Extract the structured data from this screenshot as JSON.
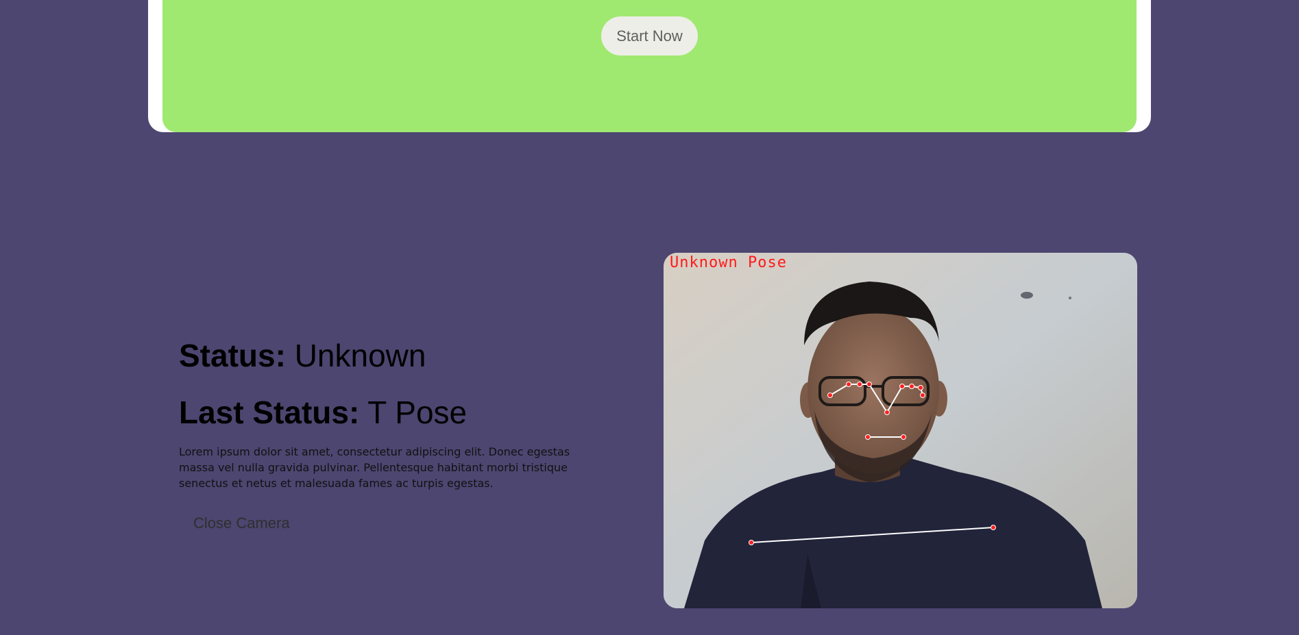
{
  "hero": {
    "start_button_label": "Start Now"
  },
  "status": {
    "status_label": "Status:",
    "status_value": "Unknown",
    "last_status_label": "Last Status:",
    "last_status_value": "T Pose",
    "description": "Lorem ipsum dolor sit amet, consectetur adipiscing elit. Donec egestas massa vel nulla gravida pulvinar. Pellentesque habitant morbi tristique senectus et netus et malesuada fames ac turpis egestas.",
    "close_button_label": "Close Camera"
  },
  "camera": {
    "overlay_label": "Unknown Pose",
    "overlay_color": "#ff1a1a",
    "landmark_color": "#ff2020",
    "skeleton_color": "#ffffff"
  },
  "colors": {
    "background": "#4c4670",
    "hero_panel": "#a0e970",
    "hero_frame": "#ffffff",
    "start_button_bg": "#eeeee8"
  }
}
